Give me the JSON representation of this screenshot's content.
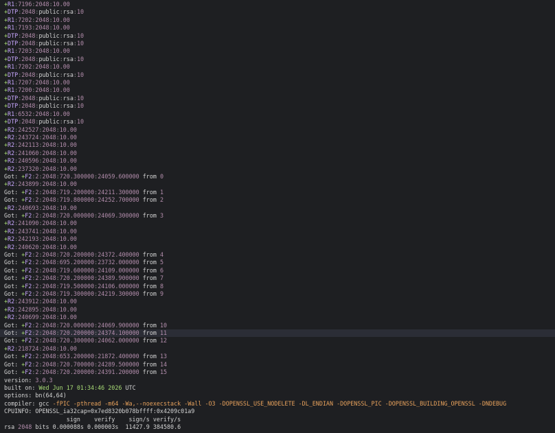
{
  "terminal": {
    "lines": [
      {
        "kind": "r1",
        "text": "+R1:7196:2048:10.00"
      },
      {
        "kind": "dtp",
        "text": "+DTP:2048:public:rsa:10"
      },
      {
        "kind": "r1",
        "text": "+R1:7202:2048:10.00"
      },
      {
        "kind": "r1",
        "text": "+R1:7193:2048:10.00"
      },
      {
        "kind": "dtp",
        "text": "+DTP:2048:public:rsa:10"
      },
      {
        "kind": "dtp",
        "text": "+DTP:2048:public:rsa:10"
      },
      {
        "kind": "r1",
        "text": "+R1:7203:2048:10.00"
      },
      {
        "kind": "dtp",
        "text": "+DTP:2048:public:rsa:10"
      },
      {
        "kind": "r1",
        "text": "+R1:7202:2048:10.00"
      },
      {
        "kind": "dtp",
        "text": "+DTP:2048:public:rsa:10"
      },
      {
        "kind": "r1",
        "text": "+R1:7207:2048:10.00"
      },
      {
        "kind": "r1",
        "text": "+R1:7200:2048:10.00"
      },
      {
        "kind": "dtp",
        "text": "+DTP:2048:public:rsa:10"
      },
      {
        "kind": "dtp",
        "text": "+DTP:2048:public:rsa:10"
      },
      {
        "kind": "r1",
        "text": "+R1:6532:2048:10.00"
      },
      {
        "kind": "dtp",
        "text": "+DTP:2048:public:rsa:10"
      },
      {
        "kind": "r2",
        "text": "+R2:242527:2048:10.00"
      },
      {
        "kind": "r2",
        "text": "+R2:243724:2048:10.00"
      },
      {
        "kind": "r2",
        "text": "+R2:242113:2048:10.00"
      },
      {
        "kind": "r2",
        "text": "+R2:241060:2048:10.00"
      },
      {
        "kind": "r2",
        "text": "+R2:240596:2048:10.00"
      },
      {
        "kind": "r2",
        "text": "+R2:237320:2048:10.00"
      },
      {
        "kind": "got",
        "text": "+F2:2:2048:720.300000:24059.600000",
        "from": "0"
      },
      {
        "kind": "r2",
        "text": "+R2:243899:2048:10.00"
      },
      {
        "kind": "got",
        "text": "+F2:2:2048:719.200000:24211.300000",
        "from": "1"
      },
      {
        "kind": "got",
        "text": "+F2:2:2048:719.800000:24252.700000",
        "from": "2"
      },
      {
        "kind": "r2",
        "text": "+R2:240693:2048:10.00"
      },
      {
        "kind": "got",
        "text": "+F2:2:2048:720.000000:24069.300000",
        "from": "3"
      },
      {
        "kind": "r2",
        "text": "+R2:241090:2048:10.00"
      },
      {
        "kind": "r2",
        "text": "+R2:243741:2048:10.00"
      },
      {
        "kind": "r2",
        "text": "+R2:242193:2048:10.00"
      },
      {
        "kind": "r2",
        "text": "+R2:240620:2048:10.00"
      },
      {
        "kind": "got",
        "text": "+F2:2:2048:720.200000:24372.400000",
        "from": "4"
      },
      {
        "kind": "got",
        "text": "+F2:2:2048:695.200000:23732.000000",
        "from": "5"
      },
      {
        "kind": "got",
        "text": "+F2:2:2048:719.600000:24109.000000",
        "from": "6"
      },
      {
        "kind": "got",
        "text": "+F2:2:2048:720.200000:24389.900000",
        "from": "7"
      },
      {
        "kind": "got",
        "text": "+F2:2:2048:719.500000:24106.000000",
        "from": "8"
      },
      {
        "kind": "got",
        "text": "+F2:2:2048:719.300000:24219.300000",
        "from": "9"
      },
      {
        "kind": "r2",
        "text": "+R2:243912:2048:10.00"
      },
      {
        "kind": "r2",
        "text": "+R2:242895:2048:10.00"
      },
      {
        "kind": "r2",
        "text": "+R2:240699:2048:10.00"
      },
      {
        "kind": "got",
        "text": "+F2:2:2048:720.000000:24069.900000",
        "from": "10"
      },
      {
        "kind": "got",
        "text": "+F2:2:2048:720.200000:24374.100000",
        "from": "11",
        "highlight": true
      },
      {
        "kind": "got",
        "text": "+F2:2:2048:720.300000:24062.000000",
        "from": "12"
      },
      {
        "kind": "r2",
        "text": "+R2:218724:2048:10.00"
      },
      {
        "kind": "got",
        "text": "+F2:2:2048:653.200000:21872.400000",
        "from": "13"
      },
      {
        "kind": "got",
        "text": "+F2:2:2048:720.700000:24289.500000",
        "from": "14"
      },
      {
        "kind": "got",
        "text": "+F2:2:2048:720.200000:24391.200000",
        "from": "15"
      },
      {
        "kind": "kv",
        "key": "version: ",
        "value": "3.0.3",
        "vcolor": "num"
      },
      {
        "kind": "kv",
        "key": "built on: ",
        "value": "Wed Jun 17 01:34:46 2026",
        "suffix": " UTC",
        "vcolor": "green"
      },
      {
        "kind": "kv",
        "key": "options: ",
        "value": "bn(64,64)",
        "vcolor": "plain"
      },
      {
        "kind": "compiler",
        "key": "compiler: ",
        "cc": "gcc",
        "flags": " -fPIC -pthread -m64 -Wa,--noexecstack -Wall -O3 -DOPENSSL_USE_NODELETE -DL_ENDIAN -DOPENSSL_PIC -DOPENSSL_BUILDING_OPENSSL -DNDEBUG"
      },
      {
        "kind": "plain",
        "text": "CPUINFO: OPENSSL_ia32cap=0x7ed8320b078bffff:0x4209c01a9"
      },
      {
        "kind": "plain",
        "text": "                  sign    verify    sign/s verify/s"
      },
      {
        "kind": "rsa",
        "text": "rsa ",
        "bits": "2048",
        "rest": " bits 0.000088s 0.000003s  11427.9 384580.6"
      }
    ],
    "got_prefix": "Got: ",
    "from_label": " from "
  }
}
